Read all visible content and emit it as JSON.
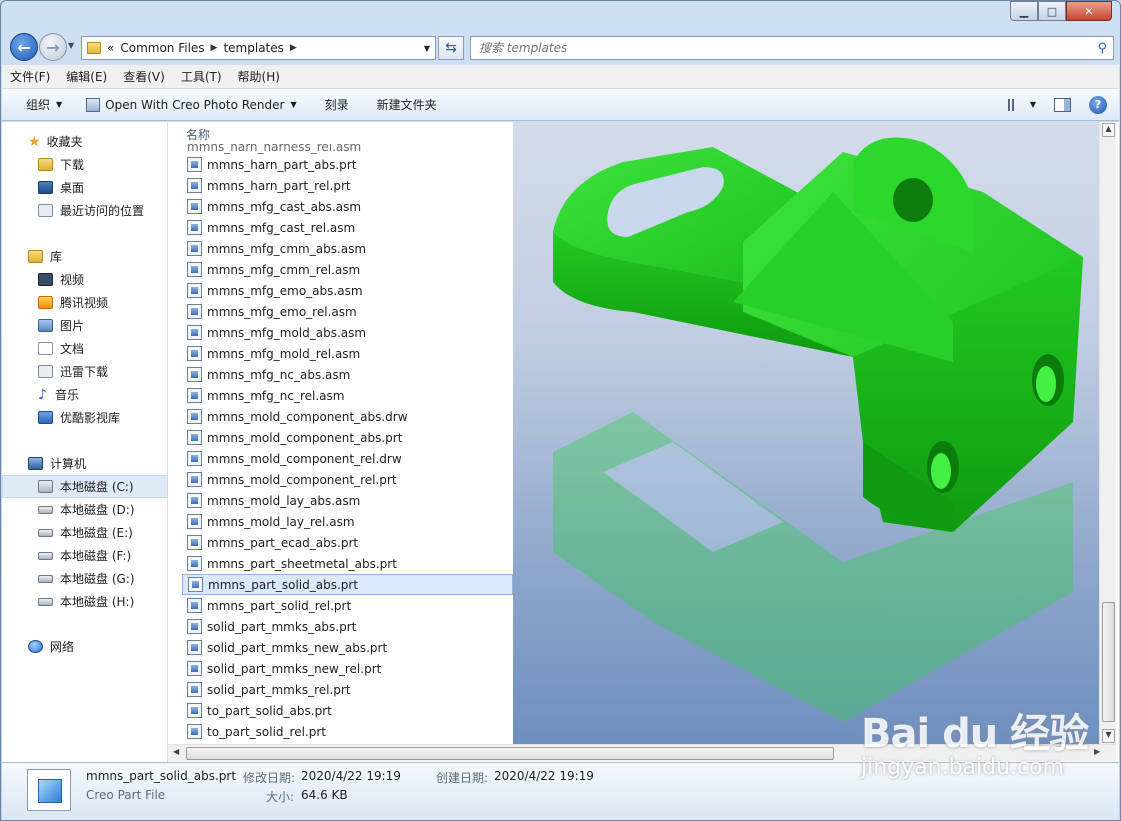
{
  "window": {
    "min_label": "▁",
    "max_label": "□",
    "close_label": "✕"
  },
  "address": {
    "overflow": "«",
    "crumbs": [
      "Common Files",
      "templates"
    ],
    "search_placeholder": "搜索 templates"
  },
  "menu": [
    "文件(F)",
    "编辑(E)",
    "查看(V)",
    "工具(T)",
    "帮助(H)"
  ],
  "toolbar": {
    "organize": "组织",
    "open_with": "Open With Creo Photo Render",
    "burn": "刻录",
    "new_folder": "新建文件夹"
  },
  "nav": {
    "favorites": {
      "label": "收藏夹",
      "items": [
        "下载",
        "桌面",
        "最近访问的位置"
      ]
    },
    "libraries": {
      "label": "库",
      "items": [
        "视频",
        "腾讯视频",
        "图片",
        "文档",
        "迅雷下载",
        "音乐",
        "优酷影视库"
      ]
    },
    "computer": {
      "label": "计算机",
      "items": [
        "本地磁盘 (C:)",
        "本地磁盘 (D:)",
        "本地磁盘 (E:)",
        "本地磁盘 (F:)",
        "本地磁盘 (G:)",
        "本地磁盘 (H:)"
      ]
    },
    "network": {
      "label": "网络"
    }
  },
  "filelist": {
    "column_name": "名称",
    "partial_top": "mmns_harn_harness_rel.asm",
    "files": [
      "mmns_harn_part_abs.prt",
      "mmns_harn_part_rel.prt",
      "mmns_mfg_cast_abs.asm",
      "mmns_mfg_cast_rel.asm",
      "mmns_mfg_cmm_abs.asm",
      "mmns_mfg_cmm_rel.asm",
      "mmns_mfg_emo_abs.asm",
      "mmns_mfg_emo_rel.asm",
      "mmns_mfg_mold_abs.asm",
      "mmns_mfg_mold_rel.asm",
      "mmns_mfg_nc_abs.asm",
      "mmns_mfg_nc_rel.asm",
      "mmns_mold_component_abs.drw",
      "mmns_mold_component_abs.prt",
      "mmns_mold_component_rel.drw",
      "mmns_mold_component_rel.prt",
      "mmns_mold_lay_abs.asm",
      "mmns_mold_lay_rel.asm",
      "mmns_part_ecad_abs.prt",
      "mmns_part_sheetmetal_abs.prt",
      "mmns_part_solid_abs.prt",
      "mmns_part_solid_rel.prt",
      "solid_part_mmks_abs.prt",
      "solid_part_mmks_new_abs.prt",
      "solid_part_mmks_new_rel.prt",
      "solid_part_mmks_rel.prt",
      "to_part_solid_abs.prt",
      "to_part_solid_rel.prt"
    ],
    "selected_index": 20
  },
  "details": {
    "name": "mmns_part_solid_abs.prt",
    "type": "Creo Part File",
    "modified_label": "修改日期:",
    "modified_value": "2020/4/22 19:19",
    "created_label": "创建日期:",
    "created_value": "2020/4/22 19:19",
    "size_label": "大小:",
    "size_value": "64.6 KB"
  },
  "watermark": {
    "main": "Bai du 经验",
    "sub": "jingyan.baidu.com"
  },
  "colors": {
    "part_green": "#1fc81f",
    "selection": "#d9e8fb"
  }
}
